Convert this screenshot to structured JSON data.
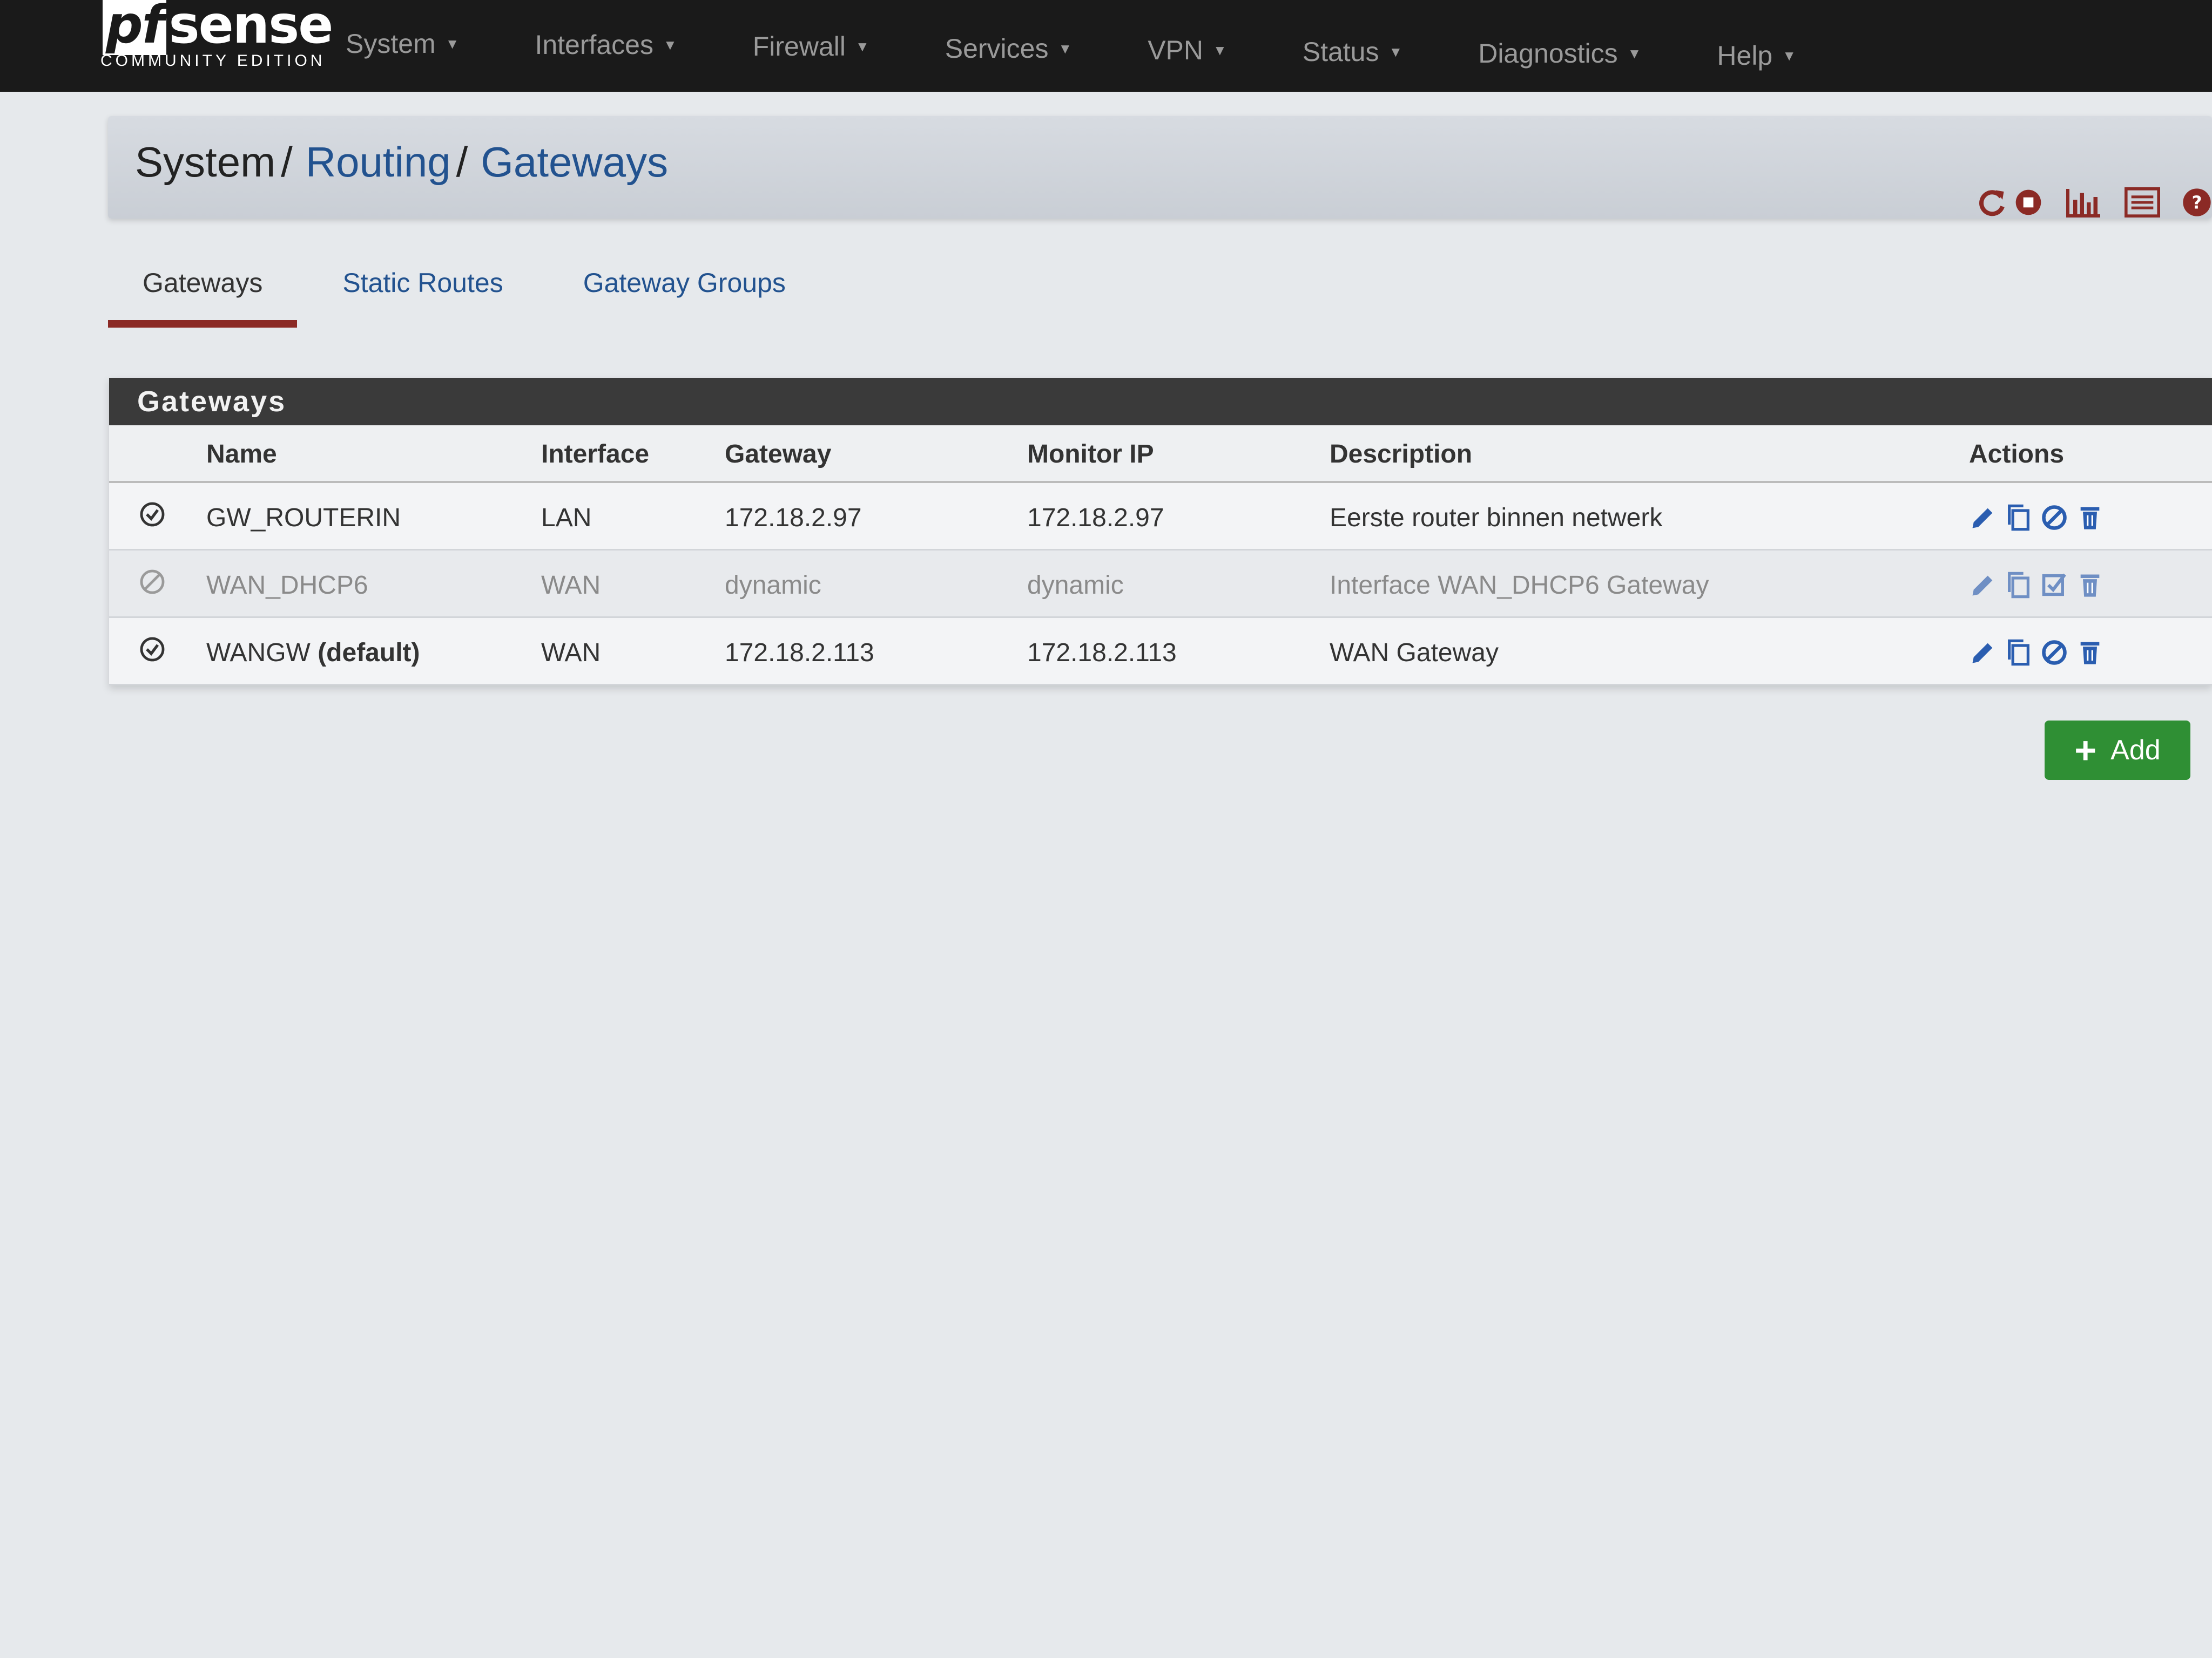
{
  "brand": {
    "logo_pf": "pf",
    "logo_sense": "sense",
    "edition": "COMMUNITY EDITION"
  },
  "nav": {
    "items": [
      {
        "label": "System"
      },
      {
        "label": "Interfaces"
      },
      {
        "label": "Firewall"
      },
      {
        "label": "Services"
      },
      {
        "label": "VPN"
      },
      {
        "label": "Status"
      },
      {
        "label": "Diagnostics"
      },
      {
        "label": "Help"
      }
    ]
  },
  "breadcrumb": {
    "part1": "System",
    "part2": "Routing",
    "part3": "Gateways",
    "separator": "/"
  },
  "tools": [
    "restart-icon",
    "stop-icon",
    "chart-icon",
    "log-icon",
    "help-icon"
  ],
  "tabs": [
    {
      "label": "Gateways",
      "active": true
    },
    {
      "label": "Static Routes",
      "active": false
    },
    {
      "label": "Gateway Groups",
      "active": false
    }
  ],
  "panel": {
    "title": "Gateways",
    "columns": {
      "name": "Name",
      "interface": "Interface",
      "gateway": "Gateway",
      "monitor_ip": "Monitor IP",
      "description": "Description",
      "actions": "Actions"
    },
    "rows": [
      {
        "status": "enabled",
        "name": "GW_ROUTERIN",
        "name_suffix": "",
        "interface": "LAN",
        "gateway": "172.18.2.97",
        "monitor_ip": "172.18.2.97",
        "description": "Eerste router binnen netwerk",
        "toggle_action": "disable-icon"
      },
      {
        "status": "disabled",
        "name": "WAN_DHCP6",
        "name_suffix": "",
        "interface": "WAN",
        "gateway": "dynamic",
        "monitor_ip": "dynamic",
        "description": "Interface WAN_DHCP6 Gateway",
        "toggle_action": "enable-icon"
      },
      {
        "status": "enabled",
        "name": "WANGW",
        "name_suffix": "(default)",
        "interface": "WAN",
        "gateway": "172.18.2.113",
        "monitor_ip": "172.18.2.113",
        "description": "WAN Gateway",
        "toggle_action": "disable-icon"
      }
    ]
  },
  "add_button": {
    "label": "Add"
  },
  "colors": {
    "navbar": "#1a1a1a",
    "link": "#22528f",
    "tab_active_underline": "#8b2a25",
    "panel_heading": "#3a3a3a",
    "add_button": "#2f8f34",
    "action_icon": "#2a5db0"
  }
}
